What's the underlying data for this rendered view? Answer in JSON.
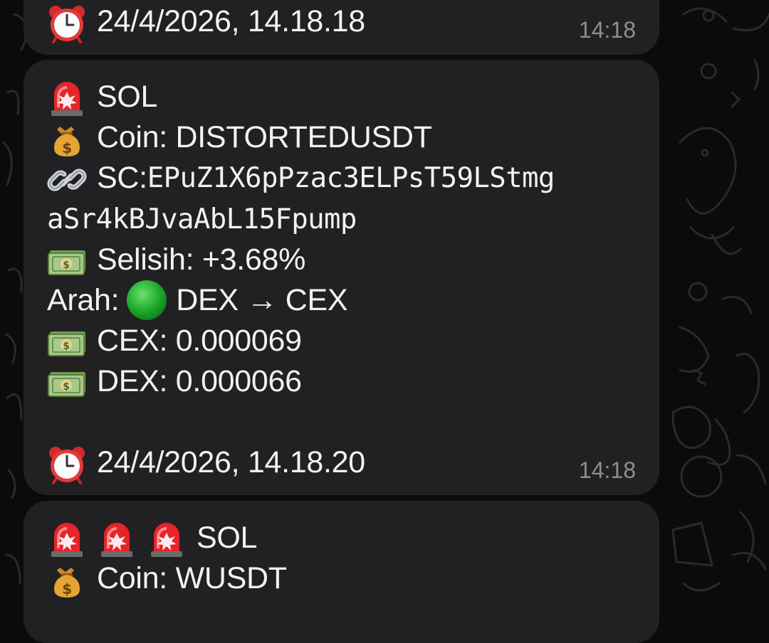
{
  "messages": [
    {
      "timestamp_line": "24/4/2026, 14.18.18",
      "time": "14:18"
    },
    {
      "title": "SOL",
      "coin_label": "Coin: DISTORTEDUSDT",
      "sc_label": "SC: ",
      "sc_part1": "EPuZ1X6pPzac3ELPsT59LStmg",
      "sc_part2": "aSr4kBJvaAbL15Fpump",
      "selisih_label": "Selisih: +3.68%",
      "arah_prefix": "Arah:",
      "arah_direction": "DEX → CEX",
      "cex_label": "CEX: 0.000069",
      "dex_label": "DEX: 0.000066",
      "timestamp_line": "24/4/2026, 14.18.20",
      "time": "14:18"
    },
    {
      "title": "SOL",
      "coin_label": "Coin: WUSDT"
    }
  ],
  "icons": {
    "alarm": "alarm-clock-icon",
    "siren": "police-siren-icon",
    "money_bag": "money-bag-icon",
    "link": "link-icon",
    "dollar_banknote": "dollar-banknote-icon",
    "green_circle": "green-circle-icon"
  },
  "colors": {
    "bubble": "#212123",
    "background": "#0b0b0c",
    "time_text": "#8e8e93",
    "green": "#1faa2c",
    "siren_red": "#e5242b"
  }
}
